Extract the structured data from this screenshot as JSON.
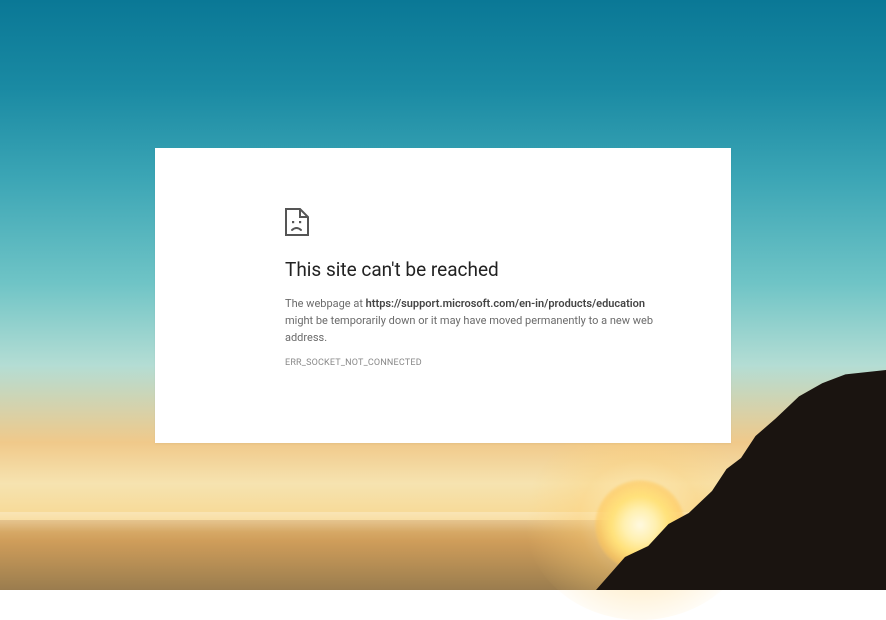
{
  "error_page": {
    "heading": "This site can't be reached",
    "message_prefix": "The webpage at ",
    "url": "https://support.microsoft.com/en-in/products/education",
    "message_suffix": " might be temporarily down or it may have moved permanently to a new web address.",
    "error_code": "ERR_SOCKET_NOT_CONNECTED"
  }
}
